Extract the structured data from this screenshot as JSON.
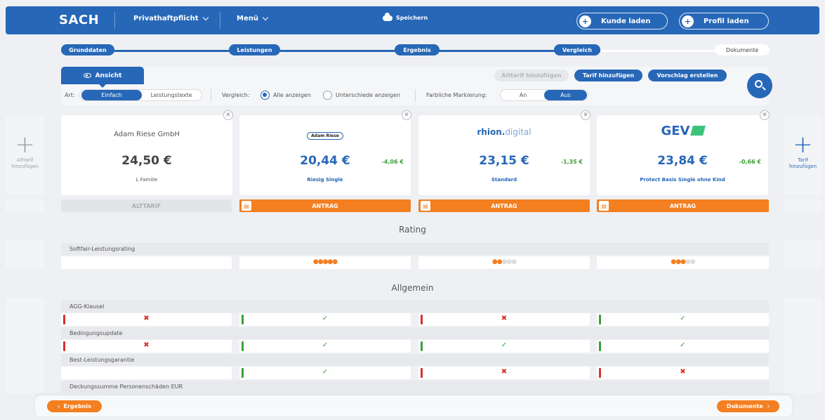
{
  "header": {
    "logo": "SACH",
    "product": "Privathaftpflicht",
    "menu": "Menü",
    "save": "Speichern",
    "load_customer": "Kunde laden",
    "load_profile": "Profil laden"
  },
  "steps": [
    "Grunddaten",
    "Leistungen",
    "Ergebnis",
    "Vergleich",
    "Dokumente"
  ],
  "toolbar": {
    "view_tab": "Ansicht",
    "add_old_tariff": "Alttarif hinzufügen",
    "add_tariff": "Tarif hinzufügen",
    "create_proposal": "Vorschlag erstellen",
    "art_label": "Art:",
    "art_simple": "Einfach",
    "art_texts": "Leistungstexte",
    "compare_label": "Vergleich:",
    "compare_all": "Alle anzeigen",
    "compare_diff": "Unterschiede anzeigen",
    "color_label": "Farbliche Markierung:",
    "color_on": "An",
    "color_off": "Aus"
  },
  "side": {
    "left_plus": "+",
    "left_label_1": "Alttarif",
    "left_label_2": "hinzufügen",
    "right_plus": "+",
    "right_label_1": "Tarif",
    "right_label_2": "hinzufügen"
  },
  "tariffs": [
    {
      "insurer": "Adam Riese GmbH",
      "price": "24,50 €",
      "diff": "",
      "tarif": "L Familie",
      "action": "ALTTARIF"
    },
    {
      "insurer": "Adam Riese",
      "price": "20,44 €",
      "diff": "-4,06 €",
      "tarif": "Riesig Single",
      "action": "ANTRAG"
    },
    {
      "insurer_a": "rhion.",
      "insurer_b": "digital",
      "price": "23,15 €",
      "diff": "-1,35 €",
      "tarif": "Standard",
      "action": "ANTRAG"
    },
    {
      "insurer": "GEV",
      "price": "23,84 €",
      "diff": "-0,66 €",
      "tarif": "Protect Basis Single ohne Kind",
      "action": "ANTRAG"
    }
  ],
  "sections": {
    "rating": "Rating",
    "general": "Allgemein"
  },
  "rows": {
    "softfair": "Softfair-Leistungsrating",
    "agg": "AGG-Klausel",
    "update": "Bedingungsupdate",
    "best": "Best-Leistungsgarantie",
    "deckung": "Deckungssumme Personenschäden EUR"
  },
  "ratings": {
    "t1": {
      "filled": "●●●●●",
      "empty": ""
    },
    "t2": {
      "filled": "●●",
      "empty": "●●●"
    },
    "t3": {
      "filled": "●●●",
      "empty": "●●"
    }
  },
  "marks": {
    "check": "✓",
    "cross": "✖"
  },
  "footer": {
    "back": "Ergebnis",
    "next": "Dokumente"
  },
  "colors": {
    "brand_blue": "#2767b7",
    "accent_orange": "#f47f20",
    "positive": "#3aa136",
    "negative": "#d9302a"
  }
}
